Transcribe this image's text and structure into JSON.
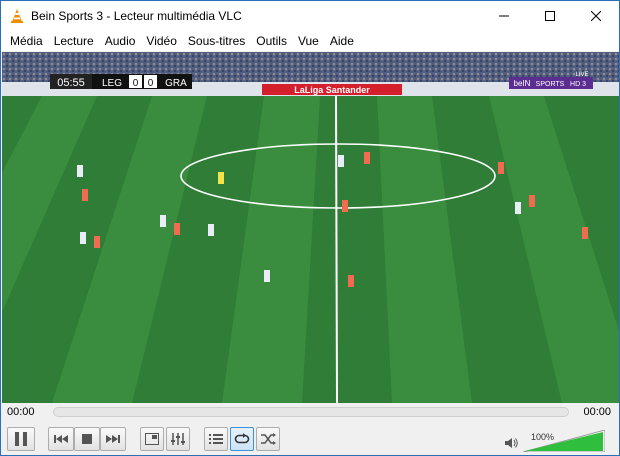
{
  "window": {
    "title": "Bein Sports 3 - Lecteur multimédia VLC",
    "icons": {
      "app": "vlc-cone-icon",
      "minimize": "minimize-icon",
      "maximize": "maximize-icon",
      "close": "close-icon"
    }
  },
  "menu": {
    "items": [
      "Média",
      "Lecture",
      "Audio",
      "Vidéo",
      "Sous-titres",
      "Outils",
      "Vue",
      "Aide"
    ]
  },
  "video": {
    "scoreboard": {
      "time": "05:55",
      "home_team": "LEG",
      "home_score": "0",
      "away_score": "0",
      "away_team": "GRA"
    },
    "banner": "LaLiga Santander",
    "broadcaster": {
      "brand": "beIN",
      "channel": "SPORTS",
      "number": "HD 3",
      "live": "LIVE"
    },
    "pitch_color": "#2f7d36"
  },
  "controls": {
    "elapsed": "00:00",
    "total": "00:00",
    "seek_progress": 0,
    "volume_label": "100%",
    "volume_level": 1.0,
    "icons": {
      "pause": "pause-icon",
      "previous": "previous-icon",
      "stop": "stop-icon",
      "next": "next-icon",
      "fullscreen": "fullscreen-icon",
      "extended": "equalizer-icon",
      "playlist": "playlist-icon",
      "loop": "loop-icon",
      "random": "shuffle-icon",
      "speaker": "speaker-icon"
    },
    "accent_color": "#3c8fd9",
    "volume_color": "#2fbf3c"
  }
}
